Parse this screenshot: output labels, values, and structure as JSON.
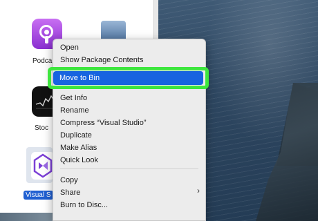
{
  "finder": {
    "icons": {
      "podcasts_label": "Podca",
      "stocks_label": "Stoc",
      "visual_studio_label": "Visual S"
    }
  },
  "context_menu": {
    "group1": [
      "Open",
      "Show Package Contents"
    ],
    "highlighted": "Move to Bin",
    "group2": [
      "Get Info",
      "Rename",
      "Compress “Visual Studio”",
      "Duplicate",
      "Make Alias",
      "Quick Look"
    ],
    "group3": [
      "Copy",
      "Share",
      "Burn to Disc..."
    ]
  },
  "colors": {
    "highlight_outline": "#3ee63e",
    "selection_blue": "#1764e0"
  },
  "icons": [
    "podcasts-icon",
    "preview-icon",
    "stocks-icon",
    "visual-studio-icon",
    "chevron-right-icon"
  ]
}
